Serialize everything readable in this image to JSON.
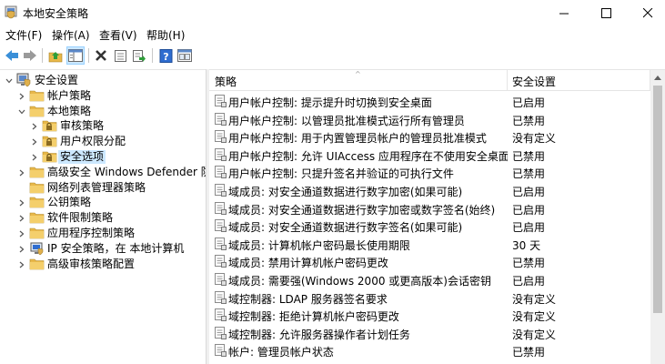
{
  "window": {
    "title": "本地安全策略"
  },
  "menu": [
    "文件(F)",
    "操作(A)",
    "查看(V)",
    "帮助(H)"
  ],
  "toolbar": {
    "buttons": [
      "back-icon",
      "forward-icon",
      "up-folder-icon",
      "show-tree-icon",
      "delete-icon",
      "properties-icon",
      "export-icon",
      "help-icon",
      "console-icon"
    ]
  },
  "tree": {
    "items": [
      {
        "label": "安全设置",
        "level": 0,
        "expanded": true,
        "icon": "computer-shield-icon"
      },
      {
        "label": "帐户策略",
        "level": 1,
        "expanded": false,
        "icon": "folder-icon"
      },
      {
        "label": "本地策略",
        "level": 1,
        "expanded": true,
        "icon": "folder-icon"
      },
      {
        "label": "审核策略",
        "level": 2,
        "expanded": false,
        "icon": "folder-lock-icon"
      },
      {
        "label": "用户权限分配",
        "level": 2,
        "expanded": false,
        "icon": "folder-lock-icon"
      },
      {
        "label": "安全选项",
        "level": 2,
        "expanded": false,
        "icon": "folder-lock-icon",
        "selected": true
      },
      {
        "label": "高级安全 Windows Defender 防火墙",
        "level": 1,
        "expanded": false,
        "icon": "folder-icon"
      },
      {
        "label": "网络列表管理器策略",
        "level": 1,
        "expanded": null,
        "icon": "folder-icon"
      },
      {
        "label": "公钥策略",
        "level": 1,
        "expanded": false,
        "icon": "folder-icon"
      },
      {
        "label": "软件限制策略",
        "level": 1,
        "expanded": false,
        "icon": "folder-icon"
      },
      {
        "label": "应用程序控制策略",
        "level": 1,
        "expanded": false,
        "icon": "folder-icon"
      },
      {
        "label": "IP 安全策略，在 本地计算机",
        "level": 1,
        "expanded": false,
        "icon": "ip-security-icon"
      },
      {
        "label": "高级审核策略配置",
        "level": 1,
        "expanded": false,
        "icon": "folder-icon"
      }
    ]
  },
  "list": {
    "columns": {
      "policy": "策略",
      "setting": "安全设置"
    },
    "rows": [
      {
        "policy": "用户帐户控制: 提示提升时切换到安全桌面",
        "setting": "已启用"
      },
      {
        "policy": "用户帐户控制: 以管理员批准模式运行所有管理员",
        "setting": "已禁用"
      },
      {
        "policy": "用户帐户控制: 用于内置管理员帐户的管理员批准模式",
        "setting": "没有定义"
      },
      {
        "policy": "用户帐户控制: 允许 UIAccess 应用程序在不使用安全桌面的...",
        "setting": "已禁用"
      },
      {
        "policy": "用户帐户控制: 只提升签名并验证的可执行文件",
        "setting": "已禁用"
      },
      {
        "policy": "域成员: 对安全通道数据进行数字加密(如果可能)",
        "setting": "已启用"
      },
      {
        "policy": "域成员: 对安全通道数据进行数字加密或数字签名(始终)",
        "setting": "已启用"
      },
      {
        "policy": "域成员: 对安全通道数据进行数字签名(如果可能)",
        "setting": "已启用"
      },
      {
        "policy": "域成员: 计算机帐户密码最长使用期限",
        "setting": "30 天"
      },
      {
        "policy": "域成员: 禁用计算机帐户密码更改",
        "setting": "已禁用"
      },
      {
        "policy": "域成员: 需要强(Windows 2000 或更高版本)会话密钥",
        "setting": "已启用"
      },
      {
        "policy": "域控制器: LDAP 服务器签名要求",
        "setting": "没有定义"
      },
      {
        "policy": "域控制器: 拒绝计算机帐户密码更改",
        "setting": "没有定义"
      },
      {
        "policy": "域控制器: 允许服务器操作者计划任务",
        "setting": "没有定义"
      },
      {
        "policy": "帐户: 管理员帐户状态",
        "setting": "已禁用"
      }
    ]
  },
  "colors": {
    "selection": "#cce8ff",
    "folder": "#e8b84a",
    "help_blue": "#2f6dd0"
  }
}
